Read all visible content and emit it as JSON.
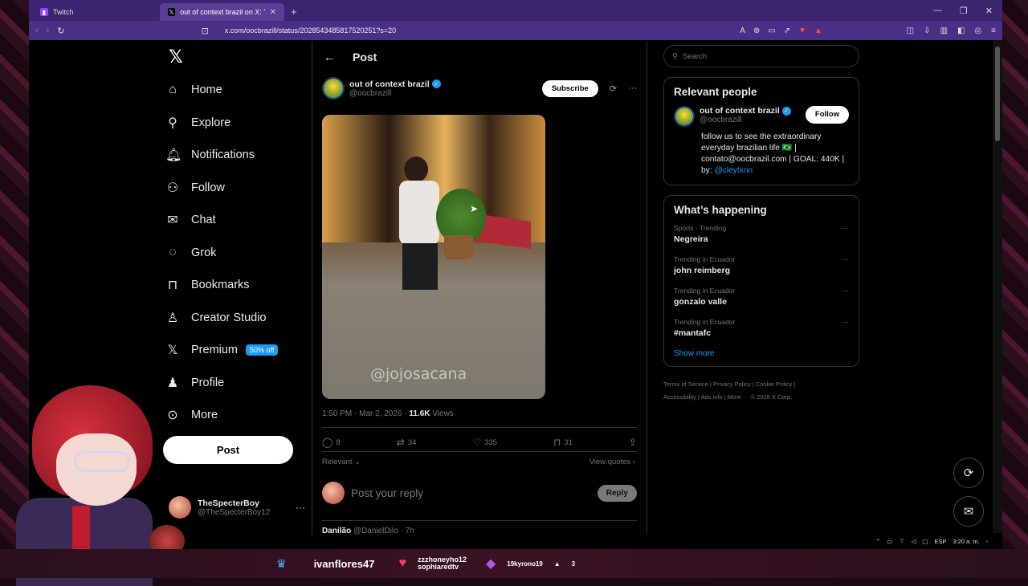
{
  "browser": {
    "tabs": [
      {
        "title": "Twitch",
        "active": false
      },
      {
        "title": "out of context brazil on X: \"H",
        "active": true
      }
    ],
    "url": "x.com/oocbrazill/status/2028543485817520251?s=20"
  },
  "nav": {
    "items": [
      {
        "label": "Home",
        "icon": "home-icon"
      },
      {
        "label": "Explore",
        "icon": "search-icon"
      },
      {
        "label": "Notifications",
        "icon": "bell-icon"
      },
      {
        "label": "Follow",
        "icon": "add-person-icon"
      },
      {
        "label": "Chat",
        "icon": "mail-icon"
      },
      {
        "label": "Grok",
        "icon": "grok-icon"
      },
      {
        "label": "Bookmarks",
        "icon": "bookmark-icon"
      },
      {
        "label": "Creator Studio",
        "icon": "creator-icon"
      },
      {
        "label": "Premium",
        "icon": "x-icon",
        "badge": "50% off"
      },
      {
        "label": "Profile",
        "icon": "person-icon"
      },
      {
        "label": "More",
        "icon": "more-circle-icon"
      }
    ],
    "post_label": "Post"
  },
  "me": {
    "name": "TheSpecterBoy",
    "handle": "@TheSpecterBoy12"
  },
  "main": {
    "title": "Post",
    "author": {
      "name": "out of context brazil",
      "handle": "@oocbrazill"
    },
    "subscribe_label": "Subscribe",
    "watermark": "@jojosacana",
    "time": "1:50 PM · Mar 2, 2026 ·",
    "views": "11.6K",
    "views_label": "Views",
    "actions": {
      "replies": "8",
      "reposts": "34",
      "likes": "335",
      "bookmarks": "31"
    },
    "relevant_label": "Relevant",
    "view_quotes_label": "View quotes",
    "reply_placeholder": "Post your reply",
    "reply_label": "Reply",
    "next_reply": {
      "name": "Danilão",
      "handle": "@DanielDilo · 7h"
    }
  },
  "right": {
    "search_placeholder": "Search",
    "relevant_title": "Relevant people",
    "person": {
      "name": "out of context brazil",
      "handle": "@oocbrazill",
      "follow_label": "Follow",
      "bio": "follow us to see the extraordinary everyday brazilian life 🇧🇷 | contato@oocbrazil.com | GOAL: 440K | by:",
      "bio_link": "@cleytxnn"
    },
    "happening_title": "What’s happening",
    "trends": [
      {
        "meta": "Sports · Trending",
        "topic": "Negreira"
      },
      {
        "meta": "Trending in Ecuador",
        "topic": "john reimberg"
      },
      {
        "meta": "Trending in Ecuador",
        "topic": "gonzalo valle"
      },
      {
        "meta": "Trending in Ecuador",
        "topic": "#mantafc"
      }
    ],
    "show_more": "Show more",
    "footer1": "Terms of Service  |  Privacy Policy  |  Cookie Policy  |",
    "footer2": "Accessibility  |  Ads info  |  More ···  © 2026 X Corp."
  },
  "system": {
    "lang": "ESP",
    "time": "3:20 a. m."
  },
  "stream": {
    "user1": "ivanflores47",
    "user2_line1": "zzzhoneyho12",
    "user2_line2": "sophiaredtv",
    "user3": "19kyrono19",
    "user3_count": "3"
  },
  "colors": {
    "accent": "#1d9bf0",
    "titlebar": "#3b2470",
    "toolbar": "#4b2f86"
  }
}
